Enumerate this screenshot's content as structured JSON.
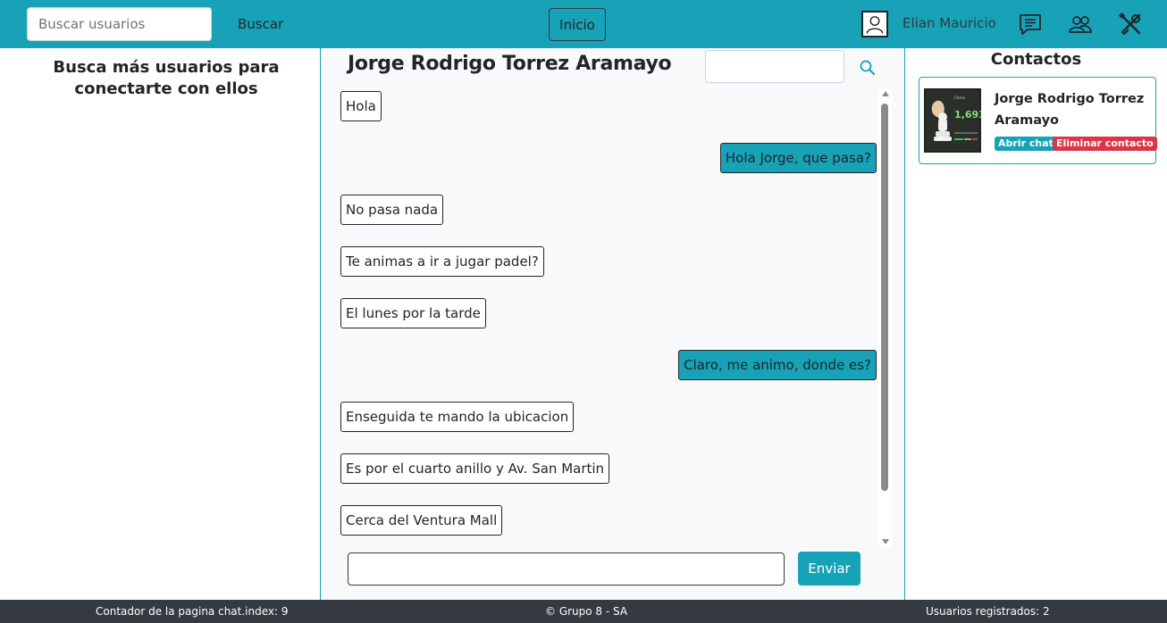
{
  "header": {
    "search_placeholder": "Buscar usuarios",
    "search_button": "Buscar",
    "home_button": "Inicio",
    "user_name": "Elian Mauricio",
    "icons": [
      "user-avatar-icon",
      "chat-icon",
      "users-icon",
      "tools-icon"
    ]
  },
  "left_panel": {
    "title": "Busca más usuarios para conectarte con ellos"
  },
  "chat": {
    "title": "Jorge Rodrigo Torrez Aramayo",
    "messages": [
      {
        "text": "Hola",
        "direction": "in"
      },
      {
        "text": "Hola Jorge, que pasa?",
        "direction": "out"
      },
      {
        "text": "No pasa nada",
        "direction": "in"
      },
      {
        "text": "Te animas a ir a jugar padel?",
        "direction": "in"
      },
      {
        "text": "El lunes por la tarde",
        "direction": "in"
      },
      {
        "text": "Claro, me animo, donde es?",
        "direction": "out"
      },
      {
        "text": "Enseguida te mando la ubicacion",
        "direction": "in"
      },
      {
        "text": "Es por el cuarto anillo y Av. San Martin",
        "direction": "in"
      },
      {
        "text": "Cerca del Ventura Mall",
        "direction": "in"
      }
    ],
    "send_button": "Enviar"
  },
  "contacts": {
    "title": "Contactos",
    "items": [
      {
        "name": "Jorge Rodrigo Torrez Aramayo",
        "open_label": "Abrir chat",
        "delete_label": "Eliminar contacto"
      }
    ]
  },
  "footer": {
    "counter": "Contador de la pagina chat.index: 9",
    "copyright": "© Grupo 8 - SA",
    "registered": "Usuarios registrados: 2"
  },
  "colors": {
    "primary": "#17a2b8",
    "danger": "#dc3545",
    "dark": "#343a40"
  }
}
